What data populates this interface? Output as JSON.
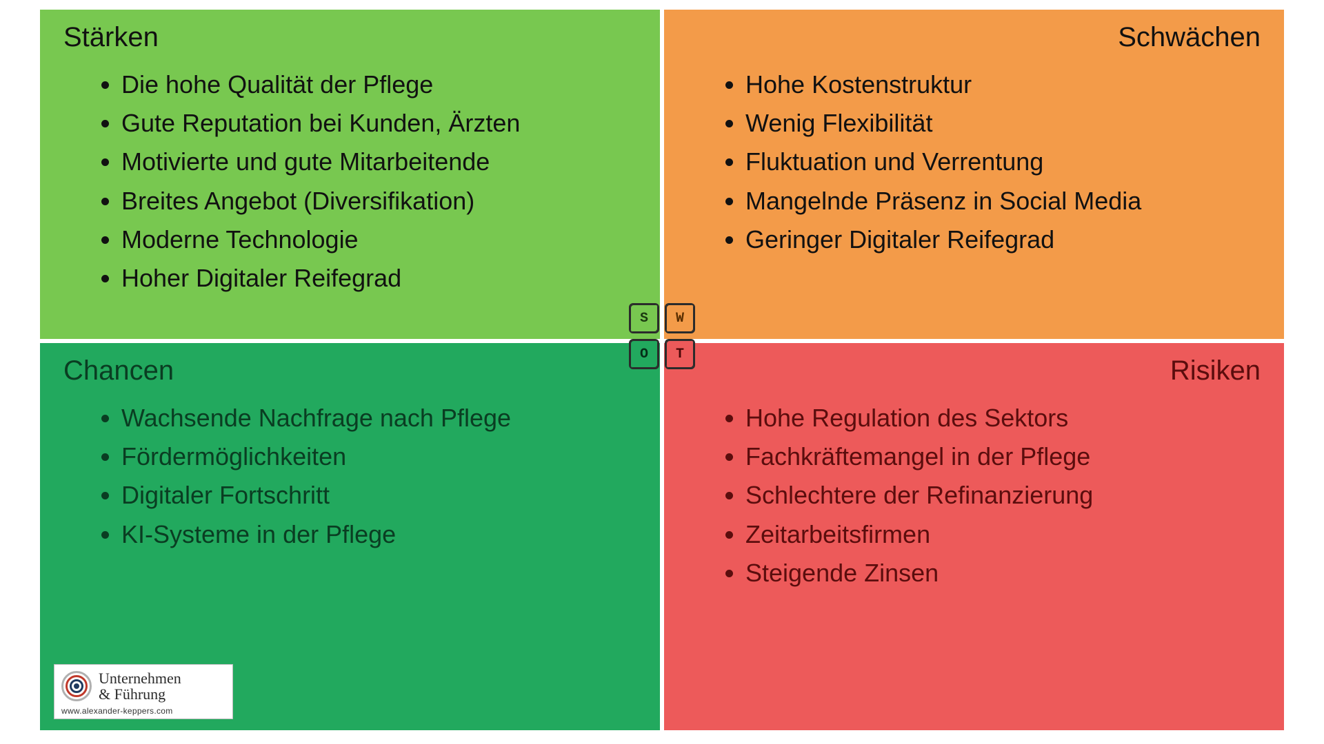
{
  "swot": {
    "s": {
      "title": "Stärken",
      "key": "S",
      "items": [
        "Die hohe Qualität der Pflege",
        "Gute Reputation bei Kunden, Ärzten",
        "Motivierte und gute Mitarbeitende",
        "Breites Angebot (Diversifikation)",
        "Moderne Technologie",
        "Hoher Digitaler Reifegrad"
      ]
    },
    "w": {
      "title": "Schwächen",
      "key": "W",
      "items": [
        "Hohe Kostenstruktur",
        "Wenig Flexibilität",
        "Fluktuation und Verrentung",
        "Mangelnde Präsenz in Social Media",
        "Geringer Digitaler Reifegrad"
      ]
    },
    "o": {
      "title": "Chancen",
      "key": "O",
      "items": [
        "Wachsende Nachfrage nach Pflege",
        "Fördermöglichkeiten",
        "Digitaler Fortschritt",
        "KI-Systeme in der Pflege"
      ]
    },
    "t": {
      "title": "Risiken",
      "key": "T",
      "items": [
        "Hohe Regulation des Sektors",
        "Fachkräftemangel in der Pflege",
        "Schlechtere der Refinanzierung",
        "Zeitarbeitsfirmen",
        "Steigende Zinsen"
      ]
    }
  },
  "brand": {
    "line1": "Unternehmen",
    "line2": "& Führung",
    "url": "www.alexander-keppers.com"
  }
}
